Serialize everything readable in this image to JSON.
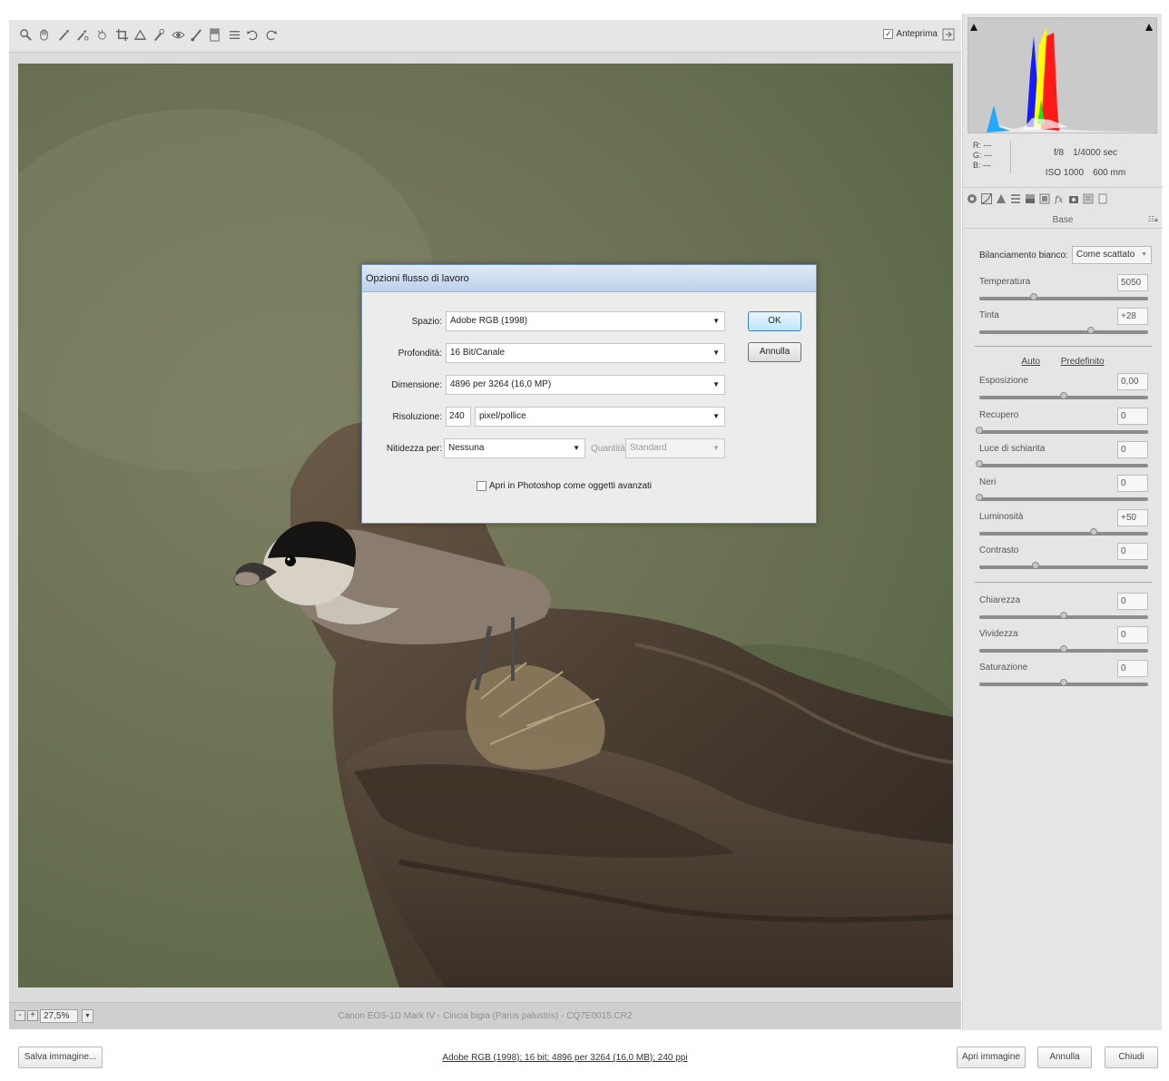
{
  "toolbar": {
    "tools": [
      "zoom-icon",
      "hand-icon",
      "white-balance-icon",
      "color-sampler-icon",
      "target-adjust-icon",
      "crop-icon",
      "straighten-icon",
      "spot-removal-icon",
      "red-eye-icon",
      "brush-icon",
      "graduated-filter-icon",
      "preferences-icon",
      "rotate-ccw-icon",
      "rotate-cw-icon"
    ],
    "preview_label": "Anteprima",
    "preview_checked": "✓"
  },
  "status": {
    "zoom_minus": "-",
    "zoom_plus": "+",
    "zoom": "27,5%",
    "zoom_arrow": "▼",
    "file_info": "Canon EOS-1D Mark IV  -  Cincia bigia (Parus palustris) - CQ7E0015.CR2"
  },
  "readout": {
    "r": "R:  ---",
    "g": "G:  ---",
    "b": "B:  ---",
    "aperture": "f/8",
    "shutter": "1/4000 sec",
    "iso": "ISO 1000",
    "focal": "600 mm"
  },
  "panel": {
    "tabs": [
      "aperture-icon",
      "tone-curve-icon",
      "detail-icon",
      "hsl-icon",
      "split-toning-icon",
      "lens-icon",
      "fx-icon",
      "camera-calibration-icon",
      "presets-icon",
      "snapshots-icon"
    ],
    "title": "Base",
    "menu_glyph": "☷▴",
    "wb_label": "Bilanciamento bianco:",
    "wb_value": "Come scattato",
    "wb_arrow": "▼",
    "auto": "Auto",
    "default": "Predefinito",
    "sliders": [
      {
        "label": "Temperatura",
        "value": "5050",
        "pos": 0.32
      },
      {
        "label": "Tinta",
        "value": "+28",
        "pos": 0.66
      },
      {
        "label": "Esposizione",
        "value": "0,00",
        "pos": 0.5
      },
      {
        "label": "Recupero",
        "value": "0",
        "pos": 0.0
      },
      {
        "label": "Luce di schiarita",
        "value": "0",
        "pos": 0.0
      },
      {
        "label": "Neri",
        "value": "0",
        "pos": 0.0
      },
      {
        "label": "Luminosità",
        "value": "+50",
        "pos": 0.675
      },
      {
        "label": "Contrasto",
        "value": "0",
        "pos": 0.335
      },
      {
        "label": "Chiarezza",
        "value": "0",
        "pos": 0.5
      },
      {
        "label": "Vividezza",
        "value": "0",
        "pos": 0.5
      },
      {
        "label": "Saturazione",
        "value": "0",
        "pos": 0.5
      }
    ]
  },
  "bottom": {
    "save": "Salva immagine...",
    "workflow": "Adobe RGB (1998); 16 bit; 4896 per 3264 (16,0 MB); 240 ppi",
    "open": "Apri immagine",
    "cancel": "Annulla",
    "close": "Chiudi"
  },
  "dialog": {
    "title": "Opzioni flusso di lavoro",
    "space_label": "Spazio:",
    "space_value": "Adobe RGB (1998)",
    "depth_label": "Profondità:",
    "depth_value": "16 Bit/Canale",
    "size_label": "Dimensione:",
    "size_value": "4896 per 3264 (16,0 MP)",
    "res_label": "Risoluzione:",
    "res_value": "240",
    "res_unit": "pixel/pollice",
    "sharpen_label": "Nitidezza per:",
    "sharpen_value": "Nessuna",
    "amount_label": "Quantità:",
    "amount_value": "Standard",
    "smart_objects": "Apri in Photoshop come oggetti avanzati",
    "ok": "OK",
    "cancel": "Annulla",
    "arrow": "▼"
  },
  "colors": {
    "histogram_blue": "#1a1aff",
    "histogram_yellow": "#ffff00",
    "histogram_red": "#ff1a1a",
    "histogram_green": "#22dd22",
    "ok_button": "#3c7fb1"
  }
}
